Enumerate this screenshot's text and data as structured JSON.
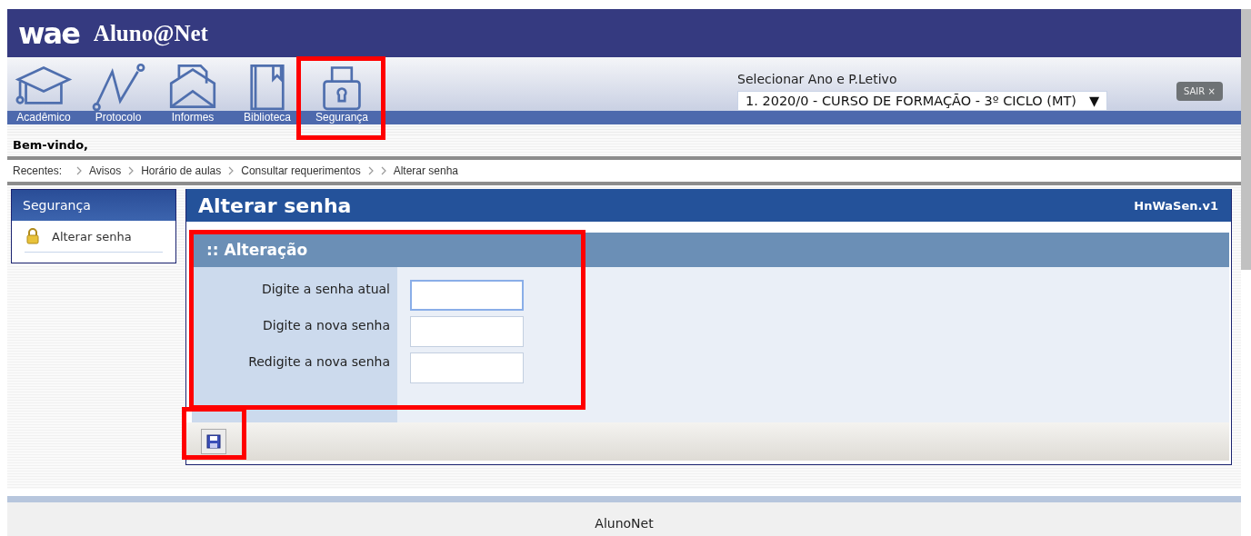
{
  "header": {
    "logo": "wae",
    "title": "Aluno@Net"
  },
  "nav": [
    {
      "label": "Acadêmico",
      "kind": "cap"
    },
    {
      "label": "Protocolo",
      "kind": "graph"
    },
    {
      "label": "Informes",
      "kind": "mail"
    },
    {
      "label": "Biblioteca",
      "kind": "book"
    },
    {
      "label": "Segurança",
      "kind": "lock"
    }
  ],
  "period": {
    "label": "Selecionar Ano e P.Letivo",
    "value": "1. 2020/0 - CURSO DE FORMAÇÃO - 3º CICLO (MT)",
    "arrow": "▼"
  },
  "logout": {
    "label": "SAIR",
    "icon": "×"
  },
  "welcome": "Bem-vindo,",
  "breadcrumb": {
    "label": "Recentes:",
    "items": [
      {
        "kind": "link",
        "label": "Avisos"
      },
      {
        "kind": "link",
        "label": "Horário de aulas"
      },
      {
        "kind": "link",
        "label": "Consultar requerimentos"
      },
      {
        "kind": "blank"
      },
      {
        "kind": "link",
        "label": "Alterar senha"
      }
    ]
  },
  "sidebar": {
    "title": "Segurança",
    "items": [
      {
        "label": "Alterar senha"
      }
    ]
  },
  "page": {
    "title": "Alterar senha",
    "code": "HnWaSen.v1",
    "section": ":: Alteração",
    "fields": [
      {
        "label": "Digite a senha atual",
        "focused": true
      },
      {
        "label": "Digite a nova senha",
        "focused": false
      },
      {
        "label": "Redigite a nova senha",
        "focused": false
      }
    ]
  },
  "footer": "AlunoNet"
}
